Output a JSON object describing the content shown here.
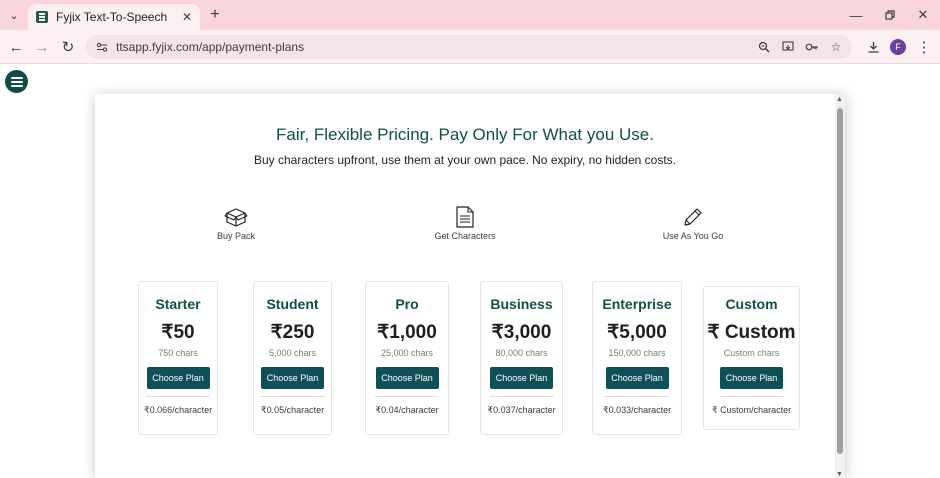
{
  "browser": {
    "tab_title": "Fyjix Text-To-Speech",
    "tab_close": "✕",
    "new_tab": "+",
    "url": "ttsapp.fyjix.com/app/payment-plans",
    "profile_initial": "F",
    "icons": [
      "tab-list-icon",
      "favicon-icon",
      "back-icon",
      "forward-icon",
      "reload-icon",
      "site-info-icon",
      "zoom-icon",
      "install-app-icon",
      "password-key-icon",
      "bookmark-star-icon",
      "download-icon",
      "minimize-icon",
      "restore-icon",
      "close-window-icon"
    ]
  },
  "page": {
    "headline": "Fair, Flexible Pricing. Pay Only For What you Use.",
    "subline": "Buy characters upfront, use them at your own pace. No expiry, no hidden costs.",
    "steps": [
      {
        "label": "Buy Pack",
        "icon": "box-icon"
      },
      {
        "label": "Get Characters",
        "icon": "document-icon"
      },
      {
        "label": "Use As You Go",
        "icon": "pencil-icon"
      }
    ],
    "plans": [
      {
        "name": "Starter",
        "price": "₹50",
        "chars": "750 chars",
        "button": "Choose Plan",
        "rate": "₹0.066/character"
      },
      {
        "name": "Student",
        "price": "₹250",
        "chars": "5,000 chars",
        "button": "Choose Plan",
        "rate": "₹0.05/character"
      },
      {
        "name": "Pro",
        "price": "₹1,000",
        "chars": "25,000 chars",
        "button": "Choose Plan",
        "rate": "₹0.04/character"
      },
      {
        "name": "Business",
        "price": "₹3,000",
        "chars": "80,000 chars",
        "button": "Choose Plan",
        "rate": "₹0.037/character"
      },
      {
        "name": "Enterprise",
        "price": "₹5,000",
        "chars": "150,000 chars",
        "button": "Choose Plan",
        "rate": "₹0.033/character"
      },
      {
        "name": "Custom",
        "price": "₹ Custom",
        "chars": "Custom chars",
        "button": "Choose Plan",
        "rate": "₹ Custom/character"
      }
    ]
  },
  "colors": {
    "tabbar": "#f9d5dd",
    "toolbar": "#fdf0f3",
    "accent_dark_teal": "#0f5048",
    "button": "#0f5058",
    "profile": "#6b3fa0"
  }
}
